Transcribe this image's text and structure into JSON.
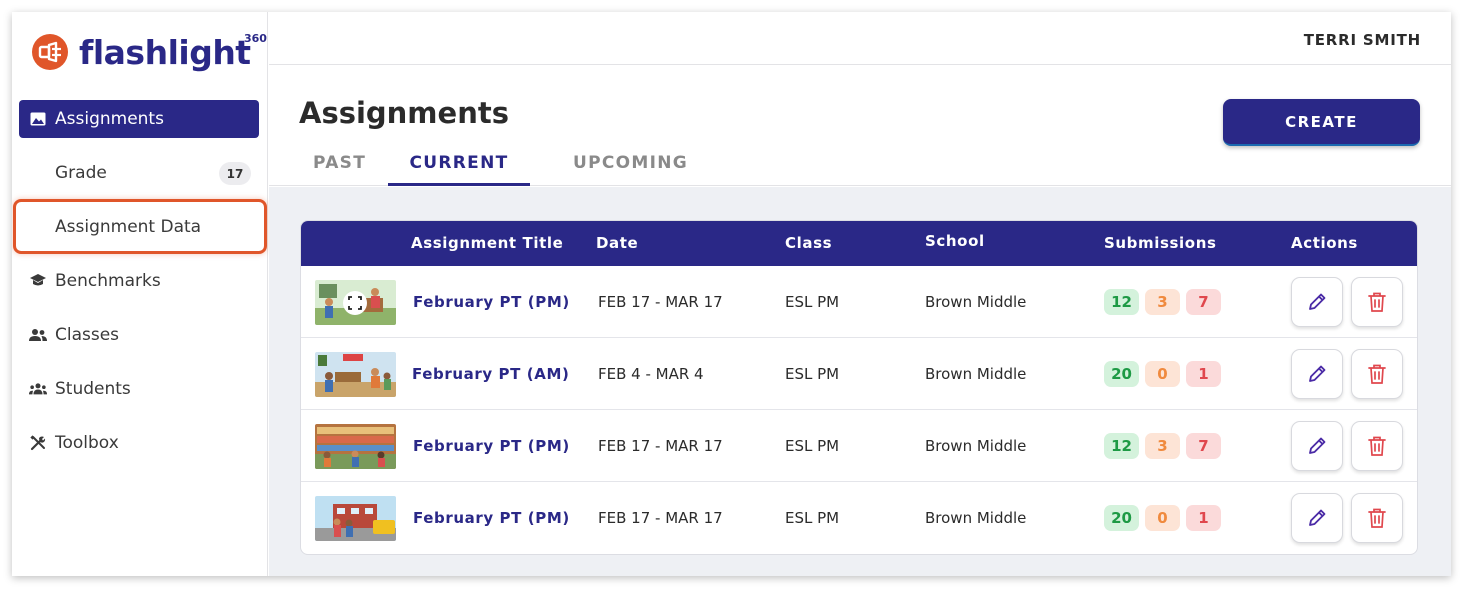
{
  "app": {
    "logo_text": "flashlight",
    "logo_sup": "360",
    "brand_color": "#2a2887",
    "logo_color": "#e0562a"
  },
  "sidebar": {
    "items": [
      {
        "label": "Assignments",
        "icon": "image-icon",
        "active": true
      },
      {
        "label": "Grade",
        "badge": "17"
      },
      {
        "label": "Assignment Data",
        "highlighted": true
      },
      {
        "label": "Benchmarks",
        "icon": "graduation-cap-icon"
      },
      {
        "label": "Classes",
        "icon": "users-icon"
      },
      {
        "label": "Students",
        "icon": "group-icon"
      },
      {
        "label": "Toolbox",
        "icon": "tools-icon"
      }
    ]
  },
  "header": {
    "user_name": "TERRI SMITH"
  },
  "page": {
    "title": "Assignments",
    "create_label": "CREATE",
    "tabs": [
      {
        "label": "PAST",
        "active": false
      },
      {
        "label": "CURRENT",
        "active": true
      },
      {
        "label": "UPCOMING",
        "active": false
      }
    ]
  },
  "table": {
    "columns": [
      "Assignment Title",
      "Date",
      "Class",
      "School",
      "Submissions",
      "Actions"
    ],
    "rows": [
      {
        "title": "February PT (PM)",
        "date": "FEB 17 - MAR 17",
        "class": "ESL PM",
        "school": "Brown Middle",
        "sub_green": "12",
        "sub_orange": "3",
        "sub_red": "7",
        "thumb": "classroom-scene-expand"
      },
      {
        "title": "February PT (AM)",
        "date": "FEB 4 - MAR 4",
        "class": "ESL PM",
        "school": "Brown Middle",
        "sub_green": "20",
        "sub_orange": "0",
        "sub_red": "1",
        "thumb": "classroom-scene"
      },
      {
        "title": "February PT (PM)",
        "date": "FEB 17 - MAR 17",
        "class": "ESL PM",
        "school": "Brown Middle",
        "sub_green": "12",
        "sub_orange": "3",
        "sub_red": "7",
        "thumb": "library-scene"
      },
      {
        "title": "February PT (PM)",
        "date": "FEB 17 - MAR 17",
        "class": "ESL PM",
        "school": "Brown Middle",
        "sub_green": "20",
        "sub_orange": "0",
        "sub_red": "1",
        "thumb": "school-bus-scene"
      }
    ]
  }
}
